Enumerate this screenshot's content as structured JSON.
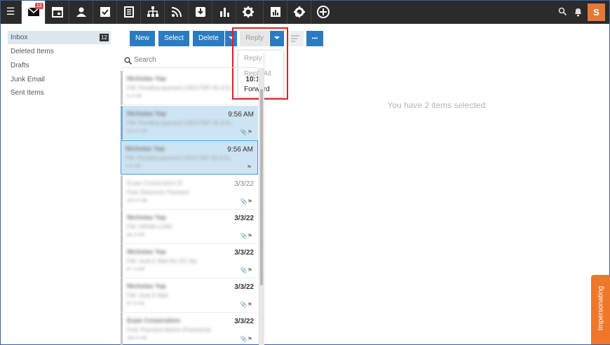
{
  "topbar": {
    "mail_badge": "12",
    "avatar": "S",
    "nav_icons": [
      "mail-icon",
      "calendar-icon",
      "contacts-icon",
      "tasks-icon",
      "notes-icon",
      "sitemap-icon",
      "rss-icon",
      "download-box-icon",
      "bar-chart-icon",
      "gear-icon",
      "server-chart-icon",
      "gear-globe-icon",
      "plus-circle-icon"
    ],
    "right_icons": [
      "search-icon",
      "bell-icon"
    ]
  },
  "sidebar": {
    "folders": [
      {
        "label": "Inbox",
        "count": "12"
      },
      {
        "label": "Deleted Items"
      },
      {
        "label": "Drafts"
      },
      {
        "label": "Junk Email"
      },
      {
        "label": "Sent Items"
      }
    ]
  },
  "toolbar": {
    "new": "New",
    "select": "Select",
    "delete": "Delete",
    "reply": "Reply",
    "more": "•••"
  },
  "reply_menu": {
    "items": [
      {
        "label": "Reply",
        "enabled": false
      },
      {
        "label": "Reply All",
        "enabled": false
      },
      {
        "label": "Forward",
        "enabled": true
      }
    ]
  },
  "search": {
    "placeholder": "Search"
  },
  "messages": [
    {
      "sender": "Nicholas Yap",
      "subject": "FW: Pending payment USD17587.65 & Eur10",
      "size": "6.2 KB",
      "time": "10:15"
    },
    {
      "sender": "Nicholas Yap",
      "subject": "FW: Pending payment USD17587.65 & Eur10",
      "size": "323.5 KB",
      "time": "9:56 AM"
    },
    {
      "sender": "Nicholas Yap",
      "subject": "FW: Pending payment USD17587.65 & Eur10",
      "size": "4.6 KB",
      "time": "9:56 AM"
    },
    {
      "sender": "Eupe Corporation Bhd",
      "subject": "Fwd: Electronic Payment",
      "size": "420.6 KB",
      "time": "3/3/22"
    },
    {
      "sender": "Nicholas Yap",
      "subject": "FW: [SPAM LOW]",
      "size": "66.3 KB",
      "time": "3/3/22"
    },
    {
      "sender": "Nicholas Yap",
      "subject": "FW: Junk E-Mail Re: KC Ng",
      "size": "67.0 KB",
      "time": "3/3/22"
    },
    {
      "sender": "Nicholas Yap",
      "subject": "FW: Junk E-Mail",
      "size": "67.0 KB",
      "time": "3/3/22"
    },
    {
      "sender": "Eupe Corporation Bhd",
      "subject": "Fwd: Payment Advice (Password)",
      "size": "360.6 KB",
      "time": "3/3/22"
    }
  ],
  "reading_pane": {
    "message": "You have 2 items selected."
  },
  "impersonating": "Impersonating"
}
